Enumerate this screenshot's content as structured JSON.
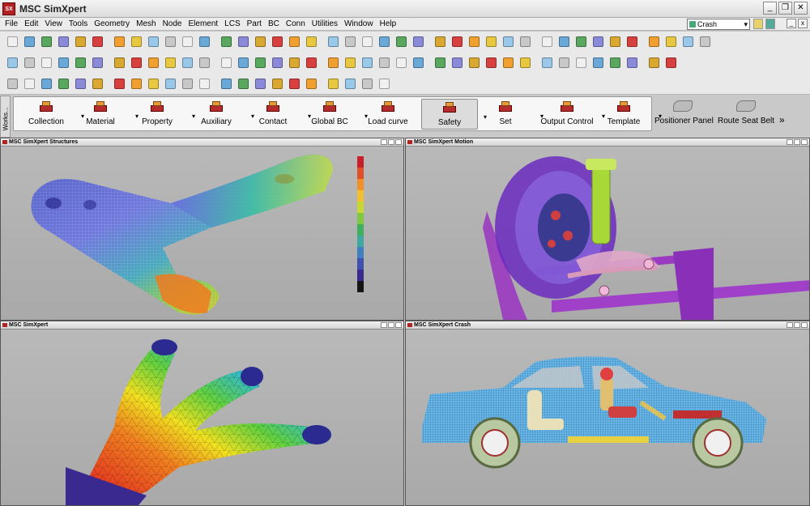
{
  "window": {
    "title": "MSC SimXpert",
    "app_icon": "SX"
  },
  "menubar": {
    "items": [
      "File",
      "Edit",
      "View",
      "Tools",
      "Geometry",
      "Mesh",
      "Node",
      "Element",
      "LCS",
      "Part",
      "BC",
      "Conn",
      "Utilities",
      "Window",
      "Help"
    ],
    "workspace_select": "Crash"
  },
  "workspace_tab": "Works...",
  "panel": {
    "buttons": [
      {
        "label": "Collection"
      },
      {
        "label": "Material"
      },
      {
        "label": "Property"
      },
      {
        "label": "Auxiliary"
      },
      {
        "label": "Contact"
      },
      {
        "label": "Global BC"
      },
      {
        "label": "Load curve"
      },
      {
        "label": "Safety"
      },
      {
        "label": "Set"
      },
      {
        "label": "Output Control"
      },
      {
        "label": "Template"
      }
    ],
    "extras": [
      {
        "label": "Positioner Panel"
      },
      {
        "label": "Route Seat Belt"
      }
    ],
    "more": "»"
  },
  "viewports": {
    "top_left": {
      "title": "MSC SimXpert Structures"
    },
    "top_right": {
      "title": "MSC SimXpert Motion"
    },
    "bottom_left": {
      "title": "MSC SimXpert"
    },
    "bottom_right": {
      "title": "MSC SimXpert Crash"
    }
  },
  "colors": {
    "legend": [
      "#c8202a",
      "#e0502a",
      "#f0902a",
      "#f0c030",
      "#c8d830",
      "#80c840",
      "#40b060",
      "#40a8a0",
      "#4080c0",
      "#4050b0",
      "#3a2a90",
      "#151515"
    ]
  }
}
